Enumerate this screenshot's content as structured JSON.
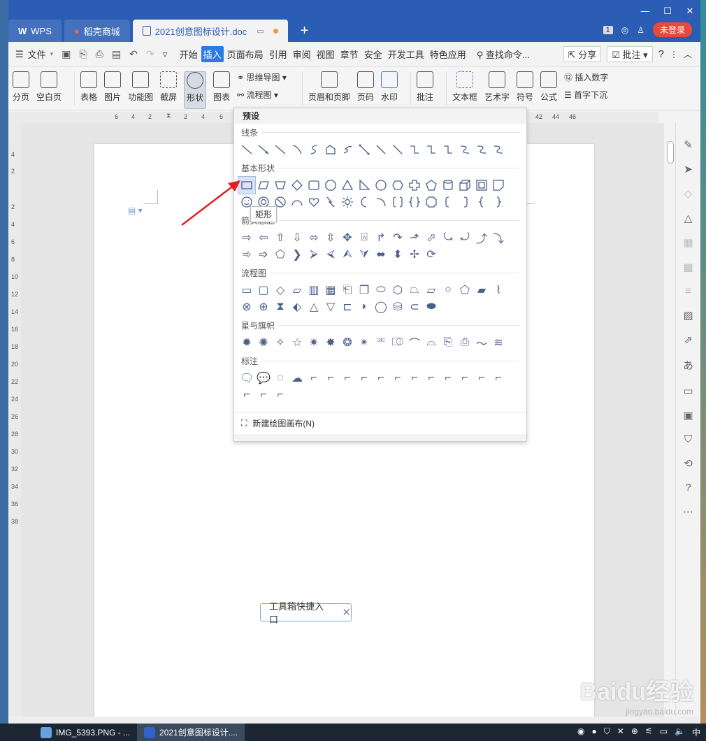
{
  "titlebar": {
    "tabs": [
      {
        "label": "WPS",
        "logo": "W"
      },
      {
        "label": "稻壳商城"
      },
      {
        "label": "2021创意图标设计.doc"
      }
    ],
    "login": "未登录",
    "badge": "1"
  },
  "menubar": {
    "file": "文件",
    "items": [
      "开始",
      "插入",
      "页面布局",
      "引用",
      "审阅",
      "视图",
      "章节",
      "安全",
      "开发工具",
      "特色应用"
    ],
    "active": "插入",
    "search": "查找命令...",
    "share": "分享",
    "comment": "批注",
    "help": "?"
  },
  "ribbon": {
    "paging": "分页",
    "blank_page": "空白页",
    "table": "表格",
    "picture": "图片",
    "function_chart": "功能图",
    "screenshot": "截屏",
    "shape": "形状",
    "chart": "图表",
    "mind_map": "思维导图",
    "flowchart": "流程图",
    "header_footer": "页眉和页脚",
    "page_number": "页码",
    "watermark": "水印",
    "comment": "批注",
    "textbox": "文本框",
    "wordart": "艺术字",
    "symbol": "符号",
    "formula": "公式",
    "insert_number": "插入数字",
    "drop_cap": "首字下沉"
  },
  "ruler": {
    "h_ticks": [
      "6",
      "4",
      "2",
      "2",
      "4",
      "6",
      "40",
      "42",
      "44",
      "46"
    ],
    "v_ticks": [
      "4",
      "2",
      "2",
      "4",
      "6",
      "8",
      "10",
      "12",
      "14",
      "16",
      "18",
      "20",
      "22",
      "24",
      "26",
      "28",
      "30",
      "32",
      "34",
      "36",
      "38"
    ]
  },
  "shape_panel": {
    "header": "预设",
    "sections": {
      "lines": "线条",
      "basic": "基本形状",
      "arrows": "箭头总汇",
      "flow": "流程图",
      "stars": "星与旗帜",
      "callouts": "标注"
    },
    "new_canvas": "新建绘图画布(N)",
    "tooltip": "矩形"
  },
  "toolbox_hint": "工具箱快捷入口",
  "taskbar": {
    "items": [
      "IMG_5393.PNG - ...",
      "2021创意图标设计...."
    ],
    "tray_text": "中"
  },
  "watermark": {
    "main": "Baidu经验",
    "sub": "jingyan.baidu.com"
  }
}
